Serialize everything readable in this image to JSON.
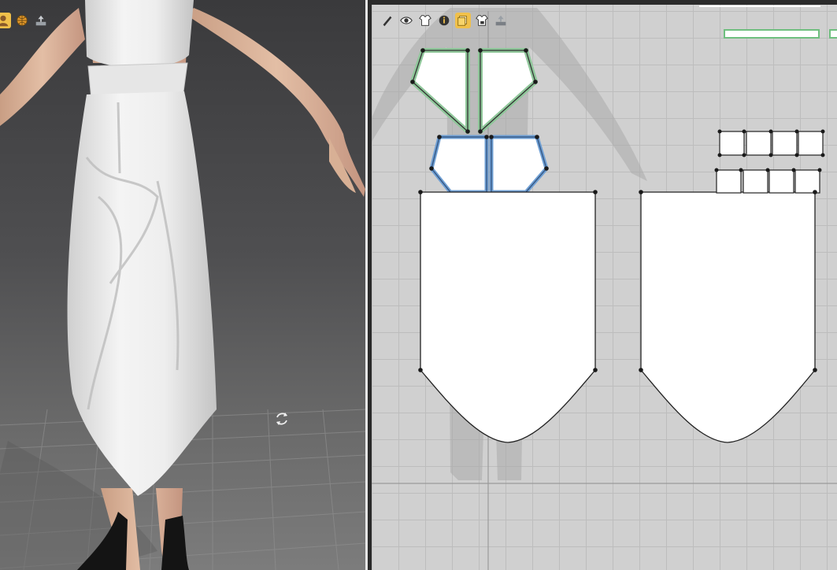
{
  "viewport_3d": {
    "toolbar": [
      {
        "icon": "avatar-icon"
      },
      {
        "icon": "globe-icon"
      },
      {
        "icon": "export-icon"
      }
    ],
    "rotate_icon": "rotate-icon"
  },
  "viewport_2d": {
    "toolbar": [
      {
        "icon": "pen-icon"
      },
      {
        "icon": "eye-icon"
      },
      {
        "icon": "shirt-eye-icon"
      },
      {
        "icon": "info-icon"
      },
      {
        "icon": "layers-icon",
        "active": true
      },
      {
        "icon": "shirt-lock-icon"
      },
      {
        "icon": "export-icon"
      }
    ],
    "patterns": [
      "bodice-front-left",
      "bodice-front-right",
      "waistband-left",
      "waistband-right",
      "skirt-front",
      "skirt-back",
      "belt-loops-top",
      "belt-loops-bottom"
    ]
  },
  "colors": {
    "toolbar_active": "#f0c04a",
    "selected_outline": "#6f9fd3",
    "highlight_green": "#7fbf8a",
    "pattern_fill": "#ffffff",
    "grid_background": "#d0d0d0"
  }
}
